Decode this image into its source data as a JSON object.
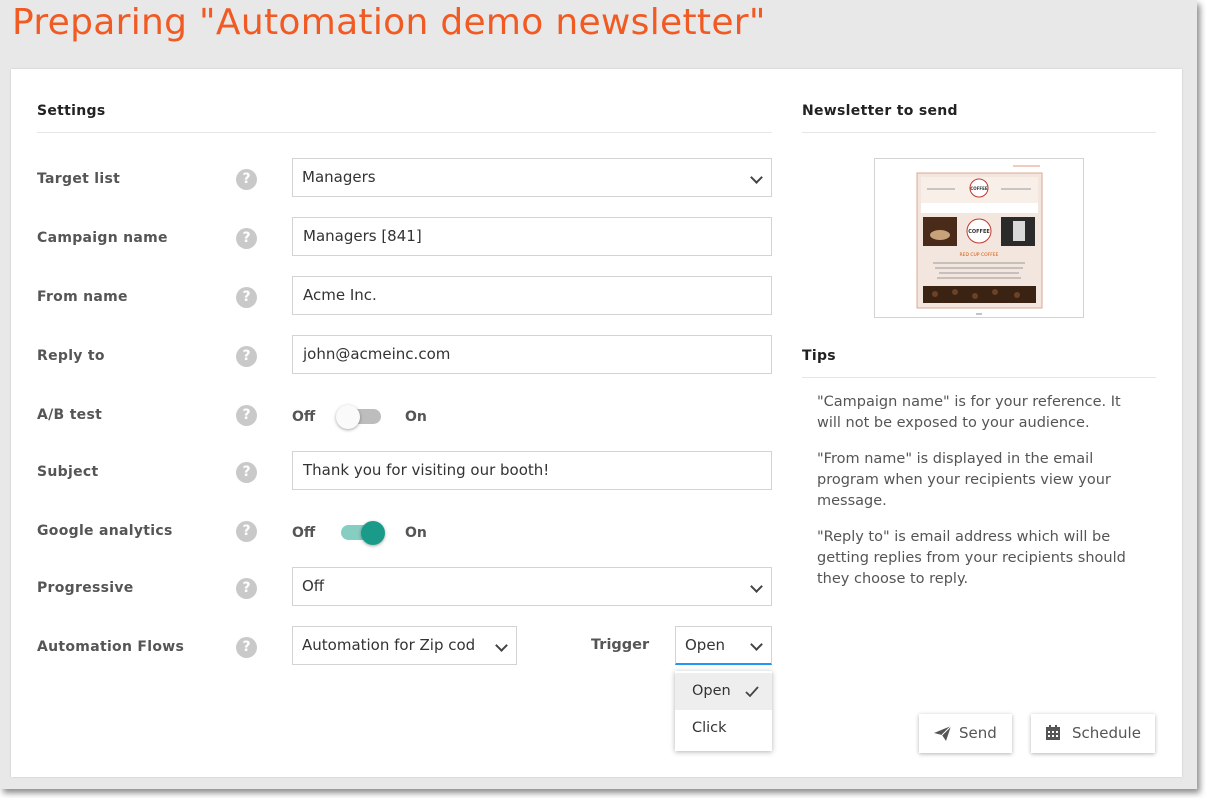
{
  "page": {
    "title": "Preparing \"Automation demo newsletter\""
  },
  "settings": {
    "heading": "Settings",
    "help_glyph": "?",
    "target_list": {
      "label": "Target list",
      "value": "Managers"
    },
    "campaign_name": {
      "label": "Campaign name",
      "value": "Managers [841]"
    },
    "from_name": {
      "label": "From name",
      "value": "Acme Inc."
    },
    "reply_to": {
      "label": "Reply to",
      "value": "john@acmeinc.com"
    },
    "ab_test": {
      "label": "A/B test",
      "off_label": "Off",
      "on_label": "On",
      "enabled": false
    },
    "subject": {
      "label": "Subject",
      "value": "Thank you for visiting our booth!"
    },
    "google_analytics": {
      "label": "Google analytics",
      "off_label": "Off",
      "on_label": "On",
      "enabled": true
    },
    "progressive": {
      "label": "Progressive",
      "value": "Off"
    },
    "automation_flows": {
      "label": "Automation Flows",
      "value": "Automation for Zip cod"
    },
    "trigger": {
      "label": "Trigger",
      "value": "Open",
      "options": [
        {
          "label": "Open",
          "selected": true
        },
        {
          "label": "Click",
          "selected": false
        }
      ]
    }
  },
  "newsletter": {
    "heading": "Newsletter to send",
    "thumbnail": {
      "brand": "COFFEE",
      "headline": "RED CUP COFFEE"
    }
  },
  "tips": {
    "heading": "Tips",
    "items": [
      "\"Campaign name\" is for your reference. It will not be exposed to your audience.",
      "\"From name\" is displayed in the email program when your recipients view your message.",
      "\"Reply to\" is email address which will be getting replies from your recipients should they choose to reply."
    ]
  },
  "actions": {
    "send_label": "Send",
    "schedule_label": "Schedule"
  },
  "icons": {
    "help": "question-circle-icon",
    "send": "paper-plane-icon",
    "schedule": "calendar-icon",
    "selected": "checkmark-icon",
    "dropdown": "chevron-down-icon"
  },
  "colors": {
    "title": "#f15a22",
    "toggle_on": "#1a9b8a",
    "toggle_on_track": "#86cdc2",
    "toggle_off_track": "#bdbdbd",
    "focus_underline": "#2196f3"
  }
}
